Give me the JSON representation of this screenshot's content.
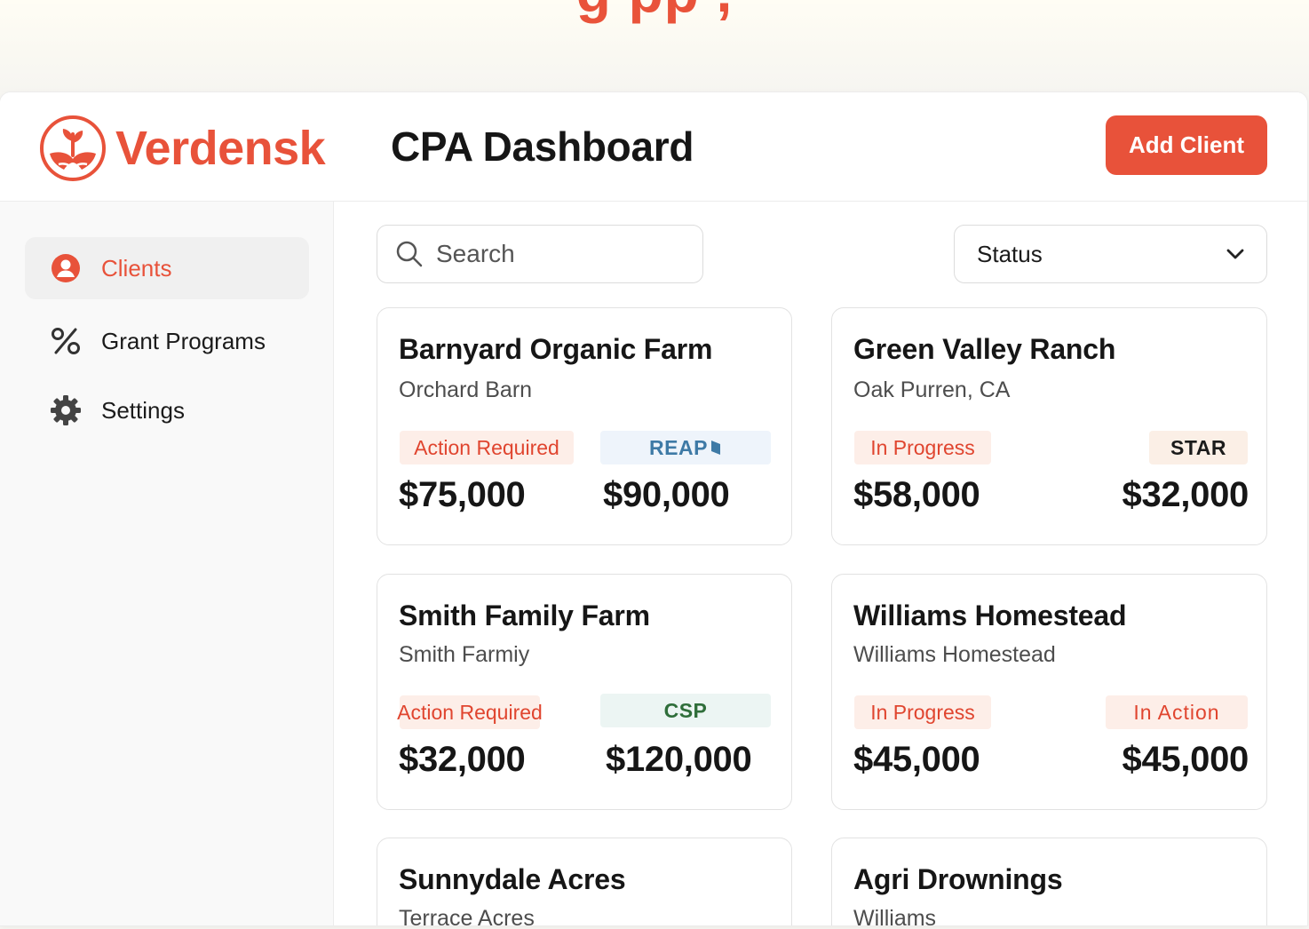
{
  "banner": {
    "text": "g  pp   ,",
    "color": "#e9533a"
  },
  "brand": {
    "name": "Verdensk",
    "color": "#e8523a"
  },
  "header": {
    "title": "CPA Dashboard",
    "add_client_label": "Add Client"
  },
  "sidebar": {
    "items": [
      {
        "label": "Clients",
        "icon": "user-circle-icon",
        "active": true
      },
      {
        "label": "Grant Programs",
        "icon": "percent-icon",
        "active": false
      },
      {
        "label": "Settings",
        "icon": "gear-icon",
        "active": false
      }
    ]
  },
  "filters": {
    "search_placeholder": "Search",
    "status_label": "Status"
  },
  "clients": [
    {
      "name": "Barnyard Organic Farm",
      "location": "Orchard Barn",
      "status": "Action Required",
      "program": "REAP",
      "amount_left": "$75,000",
      "amount_right": "$90,000"
    },
    {
      "name": "Green Valley Ranch",
      "location": "Oak Purren, CA",
      "status": "In Progress",
      "program": "STAR",
      "amount_left": "$58,000",
      "amount_right": "$32,000"
    },
    {
      "name": "Smith Family Farm",
      "location": "Smith Farmiy",
      "status": "Action Required",
      "program": "CSP",
      "amount_left": "$32,000",
      "amount_right": "$120,000"
    },
    {
      "name": "Williams Homestead",
      "location": "Williams Homestead",
      "status": "In Progress",
      "program": "In Action",
      "amount_left": "$45,000",
      "amount_right": "$45,000"
    },
    {
      "name": "Sunnydale Acres",
      "location": "Terrace Acres"
    },
    {
      "name": "Agri Drownings",
      "location": "Williams"
    }
  ],
  "colors": {
    "accent": "#e8523a",
    "status_bg": "#fdeee8",
    "reap_bg": "#eef4fb",
    "csp_bg": "#ecf5f3"
  }
}
